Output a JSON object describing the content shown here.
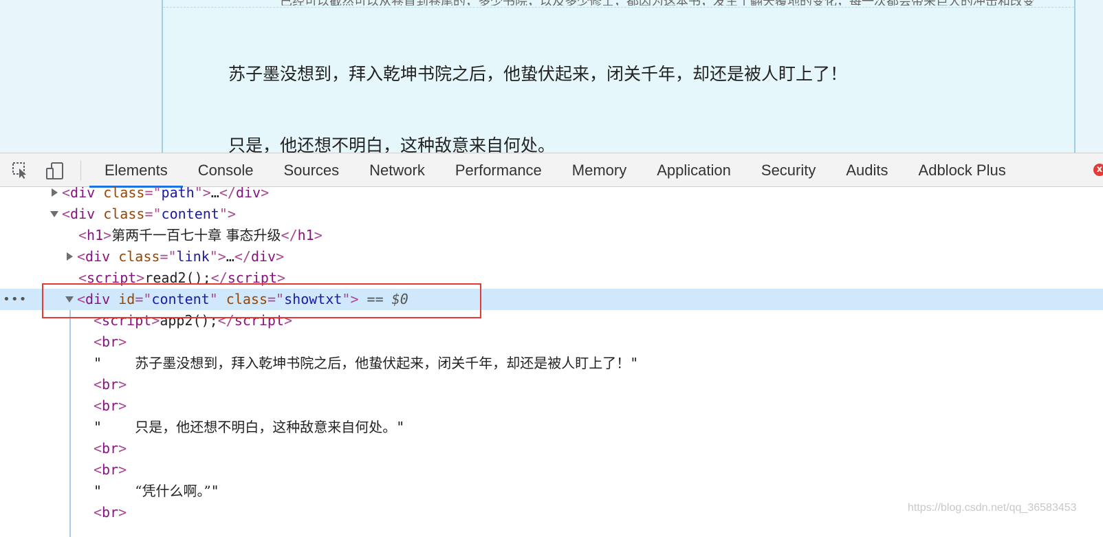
{
  "page": {
    "top_cut_text": "已经可以截然可以从卷首到卷尾的，多少书院，以及多少修士，都因为这本书，发生了翻天覆地的变化，每一次都会带来巨大的冲击和改变",
    "para1": "苏子墨没想到，拜入乾坤书院之后，他蛰伏起来，闭关千年，却还是被人盯上了！",
    "para2": "只是，他还想不明白，这种敌意来自何处。"
  },
  "devtools": {
    "tabs": [
      "Elements",
      "Console",
      "Sources",
      "Network",
      "Performance",
      "Memory",
      "Application",
      "Security",
      "Audits",
      "Adblock Plus"
    ],
    "active_tab": "Elements",
    "error_badge": "x"
  },
  "tree": {
    "l1": {
      "tag": "div",
      "attr": "class",
      "val": "path",
      "ellipsis": "…"
    },
    "l2": {
      "tag": "div",
      "attr": "class",
      "val": "content"
    },
    "l3": {
      "tag": "h1",
      "text": "第两千一百七十章 事态升级"
    },
    "l4": {
      "tag": "div",
      "attr": "class",
      "val": "link",
      "ellipsis": "…"
    },
    "l5": {
      "tag": "script",
      "text": "read2();"
    },
    "l6": {
      "tag": "div",
      "attr1": "id",
      "val1": "content",
      "attr2": "class",
      "val2": "showtxt",
      "marker": "== $0"
    },
    "l7": {
      "tag": "script",
      "text": "app2();"
    },
    "br": "br",
    "text1": "苏子墨没想到，拜入乾坤书院之后，他蛰伏起来，闭关千年，却还是被人盯上了！",
    "text2": "只是，他还想不明白，这种敌意来自何处。",
    "text3": "“凭什么啊。”"
  },
  "watermark": "https://blog.csdn.net/qq_36583453",
  "colors": {
    "selected": "#cfe8fc",
    "highlight_box": "#e53935",
    "active_tab_underline": "#1a73e8"
  }
}
